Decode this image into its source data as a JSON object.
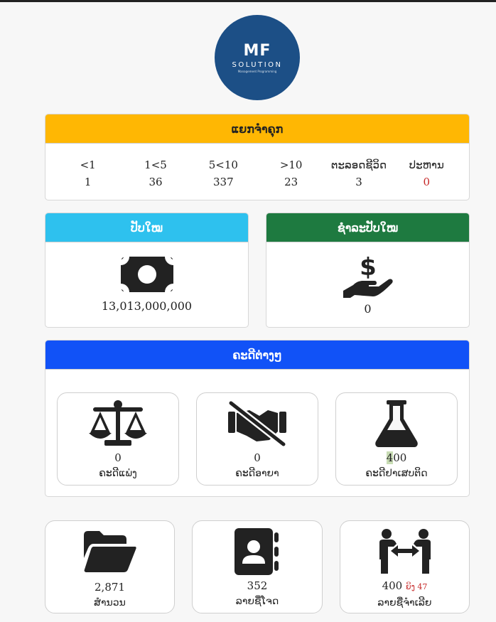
{
  "logo": {
    "line1": "MF",
    "line2": "SOLUTION",
    "line3": "Management Programming"
  },
  "age_card": {
    "title": "ແຍກຈຳຄຸກ",
    "columns": [
      {
        "header": "<1",
        "value": "1"
      },
      {
        "header": "1<5",
        "value": "36"
      },
      {
        "header": "5<10",
        "value": "337"
      },
      {
        "header": ">10",
        "value": "23"
      },
      {
        "header": "ຕະລອດຊີວິດ",
        "value": "3"
      },
      {
        "header": "ປະຫານ",
        "value": "0"
      }
    ]
  },
  "fine_card": {
    "title": "ປັບໃໝ",
    "value": "13,013,000,000",
    "icon": "money-bill-icon"
  },
  "paid_card": {
    "title": "ຊຳລະປັບໃໝ",
    "value": "0",
    "icon": "hand-holding-dollar-icon"
  },
  "cases_card": {
    "title": "ຄະດີຕ່າງໆ",
    "items": [
      {
        "value": "0",
        "label": "ຄະດີແພ່ງ",
        "icon": "scale-balanced-icon"
      },
      {
        "value": "0",
        "label": "ຄະດີອາຍາ",
        "icon": "handshake-slash-icon"
      },
      {
        "value_prefix": "4",
        "value_rest": "00",
        "label": "ຄະດີຢາເສບຕິດ",
        "icon": "flask-icon"
      }
    ]
  },
  "bottom": [
    {
      "value": "2,871",
      "label": "ສຳນວນ",
      "icon": "folder-open-icon"
    },
    {
      "value": "352",
      "label": "ລາຍຊື່ໂຈດ",
      "icon": "address-book-icon"
    },
    {
      "value": "400",
      "badge": "ຍິງ 47",
      "label": "ລາຍຊື່ຈຳເລີຍ",
      "icon": "people-arrows-icon"
    }
  ],
  "colors": {
    "yellow": "#ffb703",
    "cyan": "#2ec1ee",
    "green": "#1e7a40",
    "blue": "#1152f7",
    "logo": "#1c4f86",
    "red": "#c62828"
  }
}
